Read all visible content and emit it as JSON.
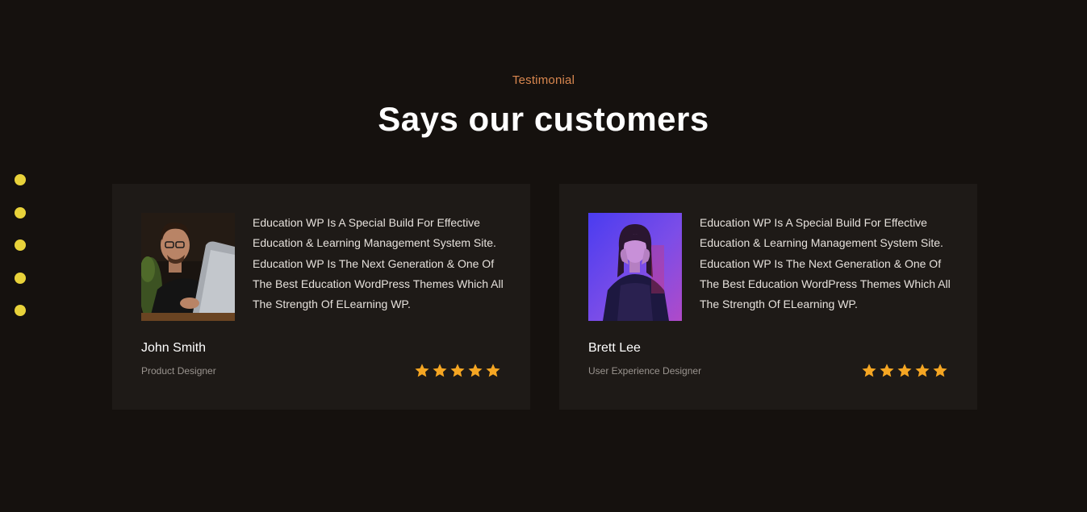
{
  "header": {
    "subtitle": "Testimonial",
    "title": "Says our customers"
  },
  "colors": {
    "background": "#15110e",
    "card": "#1e1a17",
    "accent_subtitle": "#d9874f",
    "dot": "#e8d23a",
    "star": "#f5a623"
  },
  "carousel": {
    "dot_count": 5
  },
  "testimonials": [
    {
      "name": "John Smith",
      "role": "Product Designer",
      "quote": "Education WP Is A Special Build For Effective Education & Learning Management System Site. Education WP Is The Next Generation & One Of The Best Education WordPress Themes Which All The Strength Of ELearning WP.",
      "rating": 5
    },
    {
      "name": "Brett Lee",
      "role": "User Experience Designer",
      "quote": "Education WP Is A Special Build For Effective Education & Learning Management System Site. Education WP Is The Next Generation & One Of The Best Education WordPress Themes Which All The Strength Of ELearning WP.",
      "rating": 5
    }
  ]
}
